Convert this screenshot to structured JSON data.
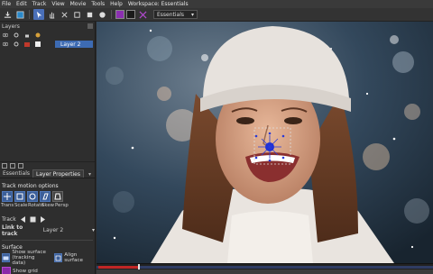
{
  "menu": [
    "File",
    "Edit",
    "Track",
    "View",
    "Movie",
    "Tools",
    "Help",
    "Workspace: Essentials"
  ],
  "toolbar": {
    "workspace_value": "Essentials",
    "workspace_arrow": "▾",
    "fg_color": "#8b2fb0",
    "bg_color": "#1a1a1a"
  },
  "layers_panel": {
    "title": "Layers",
    "layer_name": "Layer 2",
    "layer_color": "#c0392b"
  },
  "tabs": [
    "Essentials",
    "Layer Properties"
  ],
  "motion": {
    "title": "Track motion options",
    "options": [
      "Trans",
      "Scale",
      "Rotate",
      "Skew",
      "Persp"
    ]
  },
  "track": {
    "label": "Track"
  },
  "link": {
    "label": "Link to track",
    "value": "Layer 2"
  },
  "surface": {
    "title": "Surface",
    "show_surface": "Show surface",
    "tracking_data": "(tracking data)",
    "align_surface": "Align surface",
    "show_grid": "Show grid"
  },
  "timeline": {
    "position": 0.12
  }
}
